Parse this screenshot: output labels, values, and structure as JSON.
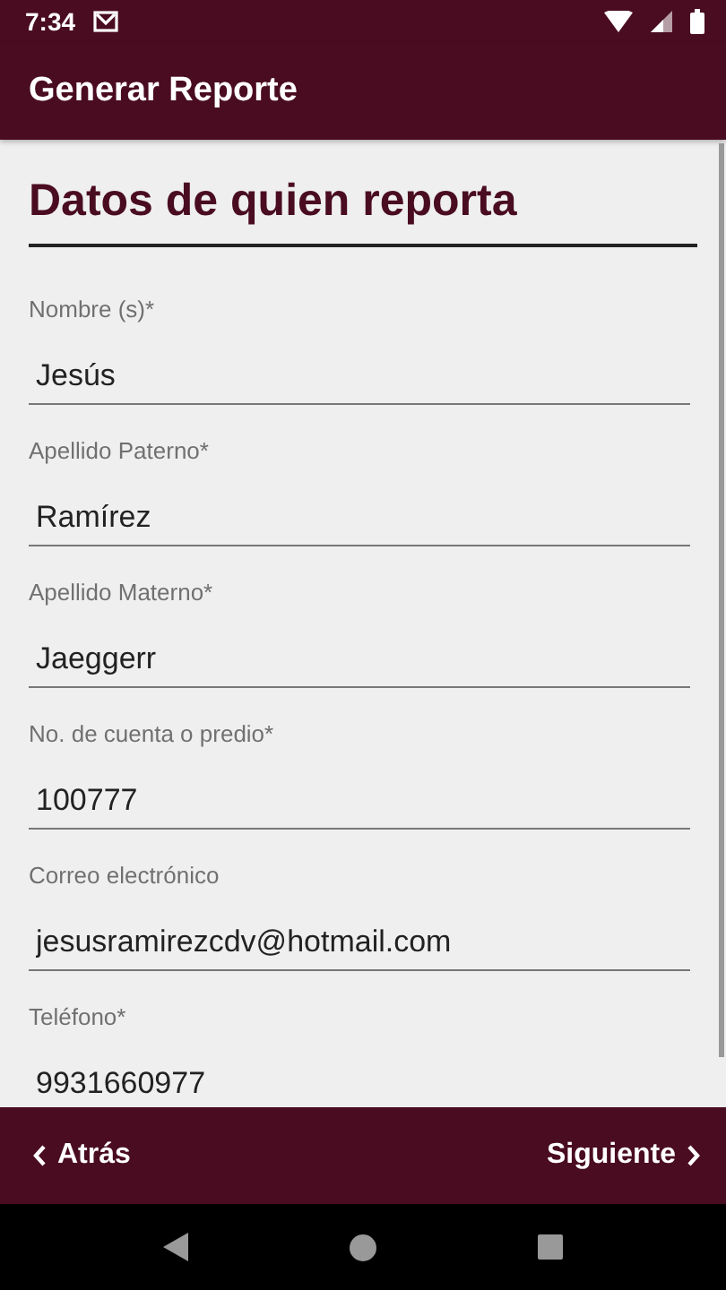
{
  "status_bar": {
    "time": "7:34"
  },
  "app_bar": {
    "title": "Generar Reporte"
  },
  "section": {
    "title": "Datos de quien reporta"
  },
  "fields": [
    {
      "label": "Nombre (s)*",
      "value": "Jesús"
    },
    {
      "label": "Apellido Paterno*",
      "value": "Ramírez"
    },
    {
      "label": "Apellido Materno*",
      "value": "Jaeggerr"
    },
    {
      "label": "No. de cuenta o predio*",
      "value": "100777"
    },
    {
      "label": "Correo electrónico",
      "value": "jesusramirezcdv@hotmail.com"
    },
    {
      "label": "Teléfono*",
      "value": "9931660977"
    }
  ],
  "bottom_bar": {
    "back": "Atrás",
    "next": "Siguiente"
  }
}
